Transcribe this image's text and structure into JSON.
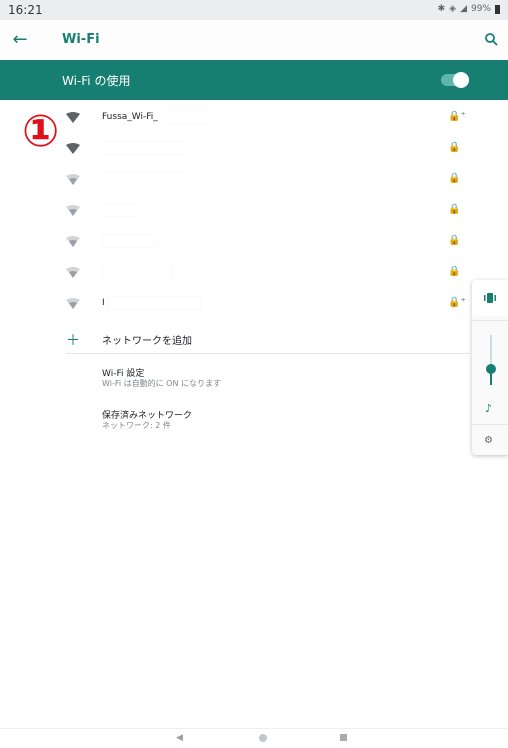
{
  "status_bar": {
    "time": "16:21",
    "battery": "99%",
    "icons": [
      "bluetooth-icon",
      "vibrate-icon",
      "signal-icon",
      "battery-icon"
    ]
  },
  "app_bar": {
    "title": "Wi-Fi",
    "back_icon": "arrow-back-icon",
    "search_icon": "search-icon"
  },
  "wifi_toggle": {
    "label": "Wi-Fi の使用",
    "state": "on"
  },
  "annotation": {
    "marker": "①",
    "color": "#e0101a"
  },
  "networks": [
    {
      "name": "Fussa_Wi-Fi_",
      "secured": true,
      "has_plus": true,
      "signal": "full"
    },
    {
      "name": "",
      "secured": true,
      "has_plus": false,
      "signal": "full"
    },
    {
      "name": "",
      "secured": true,
      "has_plus": false,
      "signal": "weak"
    },
    {
      "name": "",
      "secured": true,
      "has_plus": false,
      "signal": "weak"
    },
    {
      "name": "",
      "secured": true,
      "has_plus": false,
      "signal": "weak"
    },
    {
      "name": "",
      "secured": true,
      "has_plus": false,
      "signal": "weak"
    },
    {
      "name": "I",
      "secured": true,
      "has_plus": true,
      "signal": "weak"
    }
  ],
  "add_network": {
    "label": "ネットワークを追加",
    "icon": "plus-icon"
  },
  "settings": [
    {
      "title": "Wi-Fi 設定",
      "subtitle": "Wi-Fi は自動的に ON になります"
    },
    {
      "title": "保存済みネットワーク",
      "subtitle": "ネットワーク: 2 件"
    }
  ],
  "volume_panel": {
    "level": 0.35,
    "icons": [
      "vibrate-icon",
      "music-note-icon",
      "settings-icon"
    ]
  },
  "nav_bar": {
    "icons": [
      "back-triangle-icon",
      "home-circle-icon",
      "recents-square-icon"
    ]
  },
  "colors": {
    "accent": "#177e72",
    "accent_text": "#157f73",
    "status_bar_bg": "#ebedee"
  }
}
